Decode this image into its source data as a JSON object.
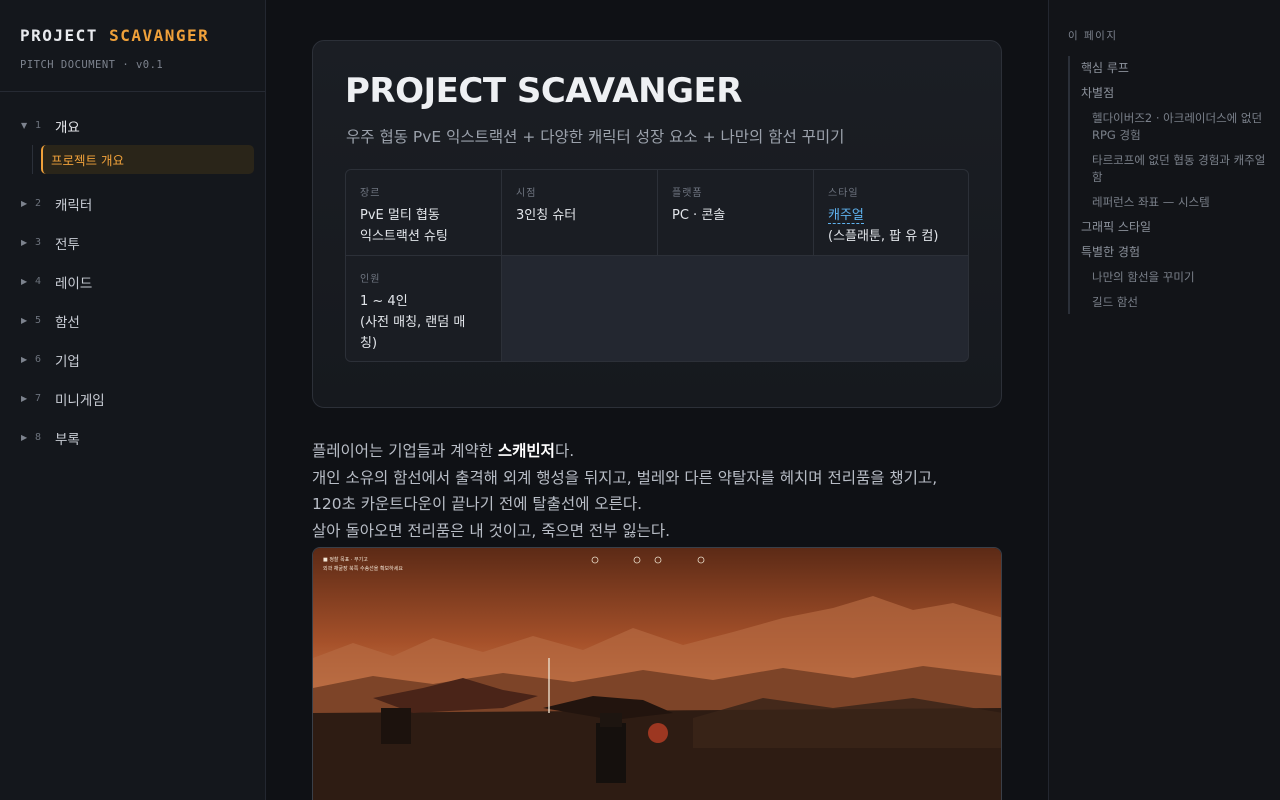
{
  "brand": {
    "title_main": "PROJECT ",
    "title_accent": "SCAVANGER",
    "subtitle": "PITCH DOCUMENT · v0.1"
  },
  "nav": [
    {
      "num": "1",
      "label": "개요",
      "open": true,
      "children": [
        "프로젝트 개요"
      ]
    },
    {
      "num": "2",
      "label": "캐릭터"
    },
    {
      "num": "3",
      "label": "전투"
    },
    {
      "num": "4",
      "label": "레이드"
    },
    {
      "num": "5",
      "label": "함선"
    },
    {
      "num": "6",
      "label": "기업"
    },
    {
      "num": "7",
      "label": "미니게임"
    },
    {
      "num": "8",
      "label": "부록"
    }
  ],
  "hero": {
    "title": "PROJECT SCAVANGER",
    "subtitle": "우주 협동 PvE 익스트랙션 + 다양한 캐릭터 성장 요소 + 나만의 함선 꾸미기",
    "info": {
      "genre": {
        "key": "장르",
        "line1": "PvE 멀티 협동",
        "line2": "익스트랙션 슈팅"
      },
      "view": {
        "key": "시점",
        "line1": "3인칭 슈터"
      },
      "platform": {
        "key": "플랫폼",
        "line1": "PC · 콘솔"
      },
      "style": {
        "key": "스타일",
        "link": "캐주얼",
        "line2": "(스플래툰, 팝 유 컴)"
      },
      "players": {
        "key": "인원",
        "line1": "1 ~ 4인",
        "line2": "(사전 매칭, 랜덤 매",
        "line3": "칭)"
      }
    }
  },
  "body": {
    "p1_pre": "플레이어는 기업들과 계약한 ",
    "p1_strong": "스캐빈저",
    "p1_post": "다.",
    "p2": "개인 소유의 함선에서 출격해 외계 행성을 뒤지고, 벌레와 다른 약탈자를 헤치며 전리품을 챙기고,",
    "p3": "120초 카운트다운이 끝나기 전에 탈출선에 오른다.",
    "p4": "살아 돌아오면 전리품은 내 것이고, 죽으면 전부 잃는다."
  },
  "screenshot": {
    "hud_line1": "■ 정찰 목표 · 무기고",
    "hud_line2": "외곽 채굴장 북쪽 수송선을 확보하세요"
  },
  "toc": {
    "heading": "이 페이지",
    "items": [
      {
        "label": "핵심 루프",
        "level": 1
      },
      {
        "label": "차별점",
        "level": 1
      },
      {
        "label": "헬다이버즈2 · 아크레이더스에 없던 RPG 경험",
        "level": 2
      },
      {
        "label": "타르코프에 없던 협동 경험과 캐주얼함",
        "level": 2
      },
      {
        "label": "레퍼런스 좌표 — 시스템",
        "level": 2
      },
      {
        "label": "그래픽 스타일",
        "level": 1
      },
      {
        "label": "특별한 경험",
        "level": 1
      },
      {
        "label": "나만의 함선을 꾸미기",
        "level": 2
      },
      {
        "label": "길드 함선",
        "level": 2
      }
    ]
  },
  "colors": {
    "accent": "#f0a13a",
    "link": "#5fb3f0",
    "background": "#0f1115"
  }
}
